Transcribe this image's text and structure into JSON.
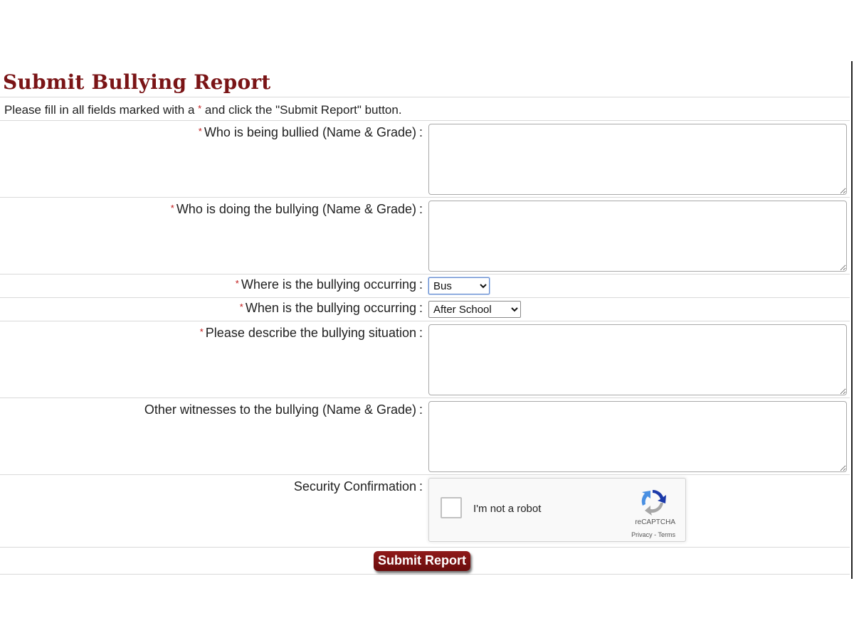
{
  "page": {
    "title": "Submit Bullying Report",
    "instructions_pre": "Please fill in all fields marked with a ",
    "instructions_star": "*",
    "instructions_post": " and click the \"Submit Report\" button."
  },
  "form": {
    "required_marker": "*",
    "colon": ":",
    "fields": {
      "victim": {
        "label": "Who is being bullied (Name & Grade)",
        "required": true,
        "value": ""
      },
      "bully": {
        "label": "Who is doing the bullying (Name & Grade)",
        "required": true,
        "value": ""
      },
      "where": {
        "label": "Where is the bullying occurring",
        "required": true,
        "selected": "Bus"
      },
      "when": {
        "label": "When is the bullying occurring",
        "required": true,
        "selected": "After School"
      },
      "description": {
        "label": "Please describe the bullying situation",
        "required": true,
        "value": ""
      },
      "witnesses": {
        "label": "Other witnesses to the bullying (Name & Grade)",
        "required": false,
        "value": ""
      },
      "security": {
        "label": "Security Confirmation",
        "required": false
      }
    },
    "captcha": {
      "checkbox_label": "I'm not a robot",
      "brand": "reCAPTCHA",
      "links": "Privacy - Terms",
      "icon": "recaptcha-logo-icon"
    },
    "submit_label": "Submit Report"
  },
  "colors": {
    "title": "#7a1416",
    "required": "#c01818",
    "submit_bg": "#7d1313",
    "divider": "#d9d9d9"
  }
}
